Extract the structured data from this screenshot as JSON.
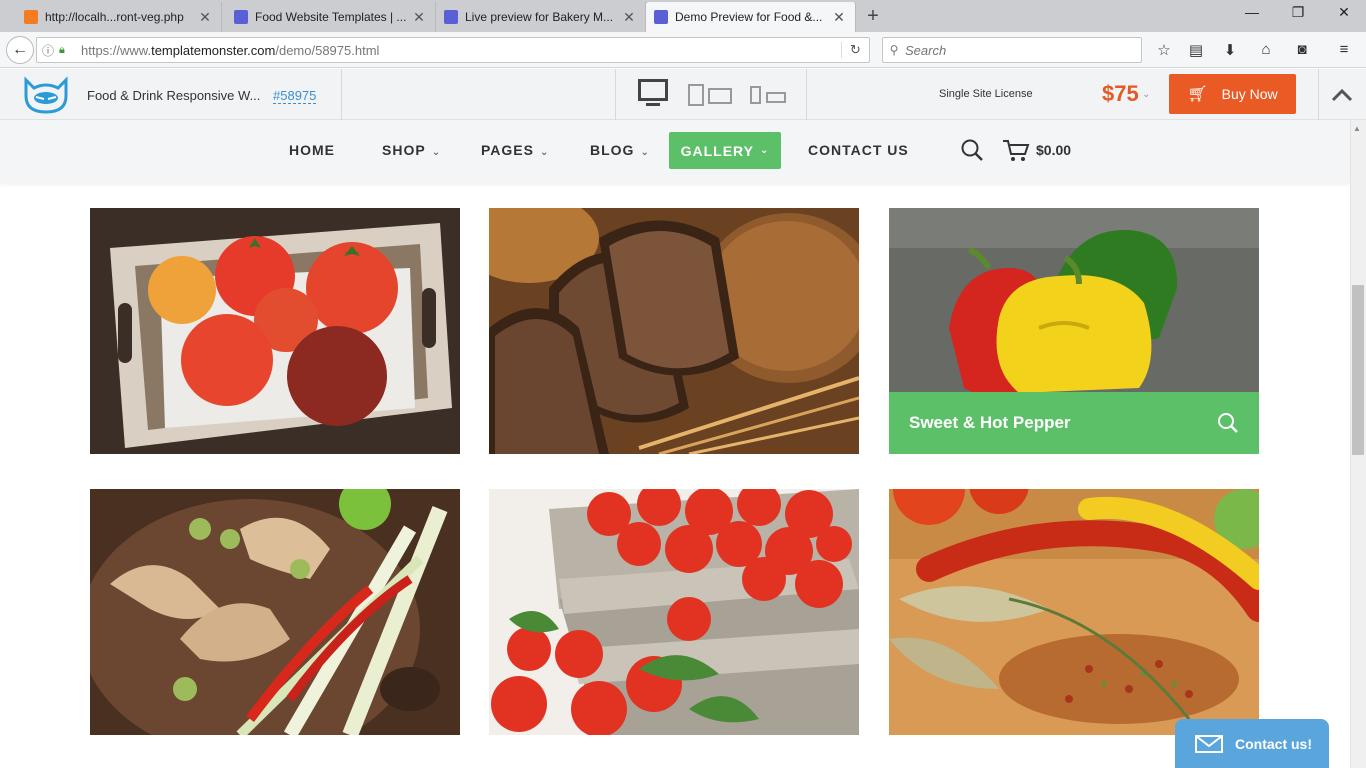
{
  "browser": {
    "tabs": [
      {
        "title": "http://localh...ront-veg.php",
        "active": false,
        "favicon": "xampp-icon"
      },
      {
        "title": "Food Website Templates | ...",
        "active": false,
        "favicon": "templatemonster-icon"
      },
      {
        "title": "Live preview for Bakery M...",
        "active": false,
        "favicon": "templatemonster-icon"
      },
      {
        "title": "Demo Preview for Food &...",
        "active": true,
        "favicon": "templatemonster-icon"
      }
    ],
    "url_prefix": "https://www.",
    "url_host": "templatemonster.com",
    "url_path": "/demo/58975.html",
    "search_placeholder": "Search"
  },
  "demo_bar": {
    "template_name": "Food & Drink Responsive W...",
    "template_id": "#58975",
    "license": "Single Site License",
    "price": "$75",
    "buy_label": "Buy Now",
    "accent_color": "#ea5a24"
  },
  "site_nav": {
    "items": [
      {
        "label": "HOME",
        "dropdown": false
      },
      {
        "label": "SHOP",
        "dropdown": true
      },
      {
        "label": "PAGES",
        "dropdown": true
      },
      {
        "label": "BLOG",
        "dropdown": true
      },
      {
        "label": "GALLERY",
        "dropdown": true,
        "active": true
      },
      {
        "label": "CONTACT US",
        "dropdown": false
      }
    ],
    "cart_total": "$0.00",
    "active_color": "#5cc068"
  },
  "gallery": {
    "tiles": [
      {
        "subject": "tomatoes-in-wooden-tray"
      },
      {
        "subject": "sliced-rye-bread"
      },
      {
        "subject": "bell-peppers",
        "caption": "Sweet & Hot Pepper",
        "hovered": true
      },
      {
        "subject": "ginger-lemongrass-chili"
      },
      {
        "subject": "tomatoes-in-crates"
      },
      {
        "subject": "chili-peppers-and-spices"
      }
    ]
  },
  "contact_widget": {
    "label": "Contact us!",
    "color": "#5aa5dc"
  }
}
